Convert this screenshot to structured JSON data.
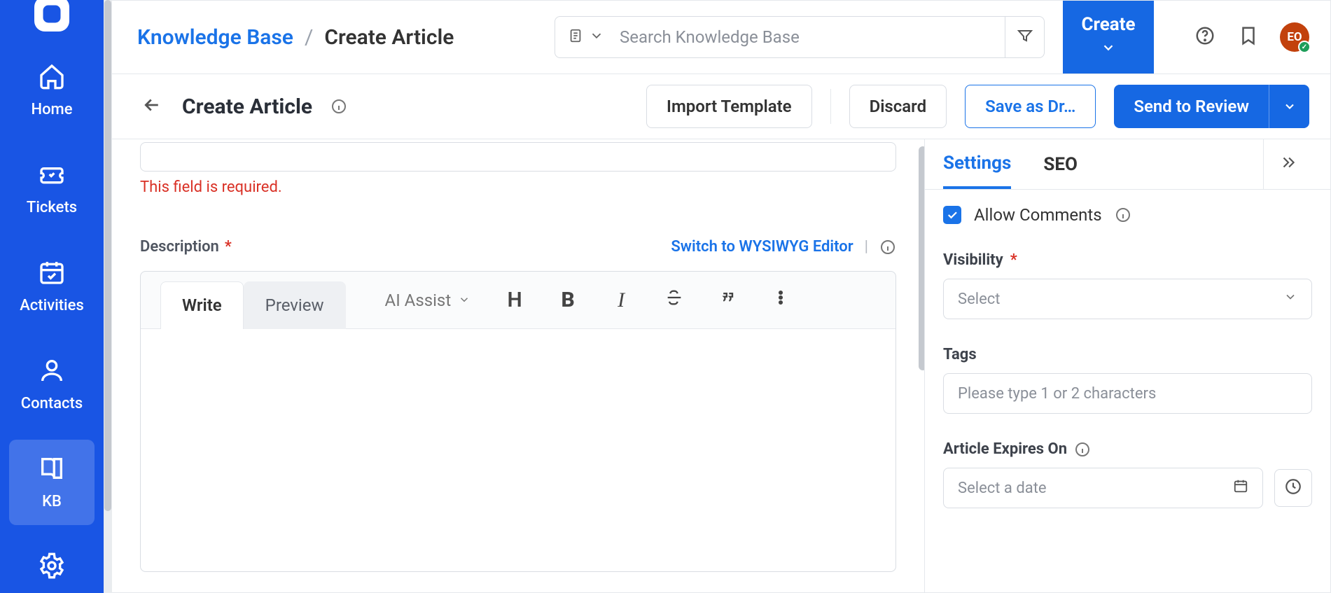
{
  "sidebar": {
    "items": [
      {
        "label": "Home"
      },
      {
        "label": "Tickets"
      },
      {
        "label": "Activities"
      },
      {
        "label": "Contacts"
      },
      {
        "label": "KB"
      }
    ]
  },
  "topbar": {
    "breadcrumb_root": "Knowledge Base",
    "breadcrumb_sep": "/",
    "breadcrumb_leaf": "Create Article",
    "search_placeholder": "Search Knowledge Base",
    "create_label": "Create",
    "avatar_initials": "EO"
  },
  "pagebar": {
    "title": "Create Article",
    "import": "Import Template",
    "discard": "Discard",
    "draft": "Save as Dr…",
    "review": "Send to Review"
  },
  "form": {
    "title_error": "This field is required.",
    "description_label": "Description",
    "switch_link": "Switch to WYSIWYG Editor",
    "switch_pipe": "|",
    "tab_write": "Write",
    "tab_preview": "Preview",
    "ai_assist": "AI Assist"
  },
  "panel": {
    "tab_settings": "Settings",
    "tab_seo": "SEO",
    "allow_comments": "Allow Comments",
    "visibility_label": "Visibility",
    "visibility_placeholder": "Select",
    "tags_label": "Tags",
    "tags_placeholder": "Please type 1 or 2 characters",
    "expires_label": "Article Expires On",
    "expires_placeholder": "Select a date"
  }
}
